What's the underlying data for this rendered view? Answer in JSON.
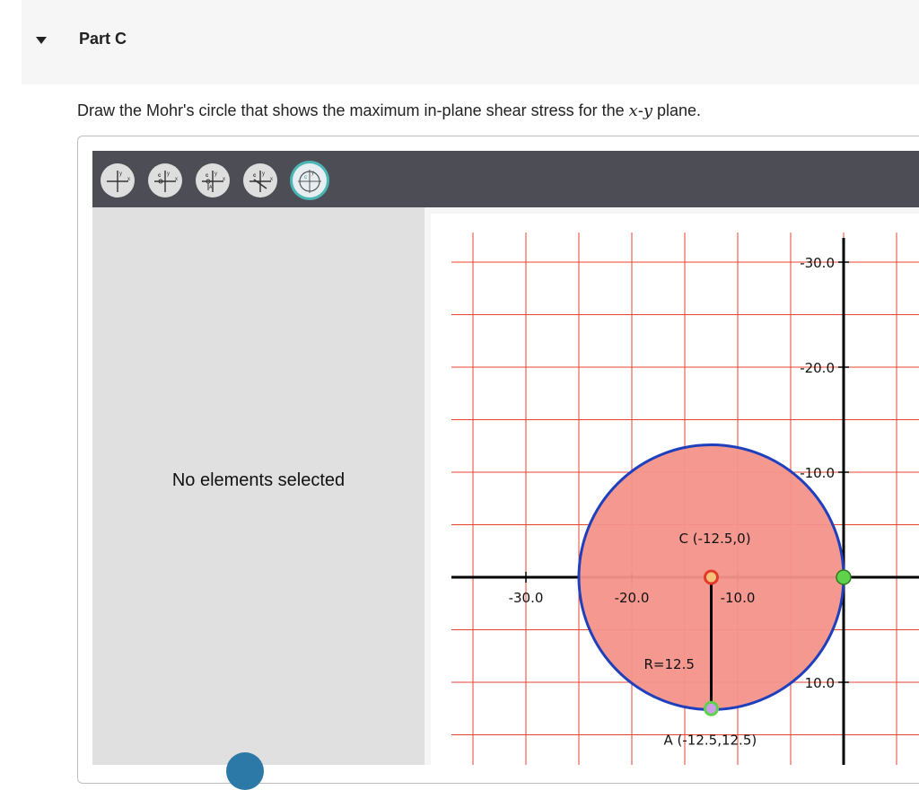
{
  "part": {
    "title": "Part C"
  },
  "instruction": {
    "before": "Draw the Mohr's circle that shows the maximum in-plane shear stress for the ",
    "x": "x",
    "dash": "-",
    "y": "y",
    "after": " plane."
  },
  "toolbar": {
    "tools": [
      {
        "name": "axes-tool",
        "active": false
      },
      {
        "name": "center-tool",
        "active": false
      },
      {
        "name": "center-point-tool",
        "active": false
      },
      {
        "name": "radius-tool",
        "active": false
      },
      {
        "name": "circle-tool",
        "active": true
      }
    ]
  },
  "left_panel": {
    "message": "No elements selected"
  },
  "chart_data": {
    "type": "scatter",
    "x_ticks": [
      "-30.0",
      "-20.0",
      "-10.0"
    ],
    "y_ticks": [
      "-30.0",
      "-20.0",
      "-10.0",
      "10.0"
    ],
    "circle": {
      "center": [
        -12.5,
        0
      ],
      "radius": 12.5
    },
    "points": [
      {
        "name": "C",
        "label": "C (-12.5,0)",
        "x": -12.5,
        "y": 0
      },
      {
        "name": "A",
        "label": "A (-12.5,12.5)",
        "x": -12.5,
        "y": 12.5
      },
      {
        "name": "right-point",
        "label": "",
        "x": 0,
        "y": 0
      }
    ],
    "radius_label": "R=12.5",
    "colors": {
      "grid": "#e8432f",
      "fill": "#f4938a",
      "outline": "#1f3fbd",
      "green": "#5fd14a",
      "center": "#e03a2a"
    },
    "grid": true
  }
}
